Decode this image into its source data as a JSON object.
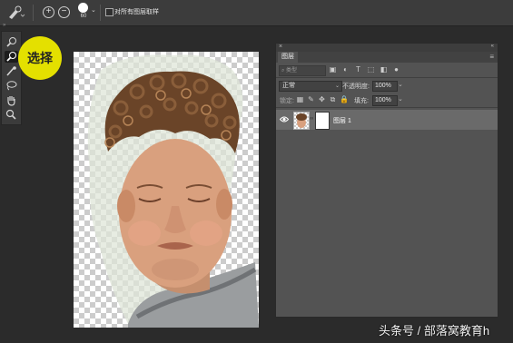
{
  "options_bar": {
    "brush_size": "60",
    "sample_all_layers_label": "对所有图层取样",
    "sample_all_layers_checked": false
  },
  "callout": {
    "label": "选择"
  },
  "layers_panel": {
    "tab_label": "图层",
    "filter_placeholder": "类型",
    "blend_mode": "正常",
    "opacity_label": "不透明度:",
    "opacity_value": "100%",
    "lock_label": "锁定:",
    "fill_label": "填充:",
    "fill_value": "100%",
    "layers": [
      {
        "name": "图层 1",
        "visible": true,
        "selected": true
      }
    ]
  },
  "watermark": "头条号 / 部落窝教育h",
  "colors": {
    "callout_yellow": "#e4e000",
    "panel_bg": "#535353",
    "selected_layer": "#6a6a6a",
    "app_bg": "#2b2b2b"
  }
}
